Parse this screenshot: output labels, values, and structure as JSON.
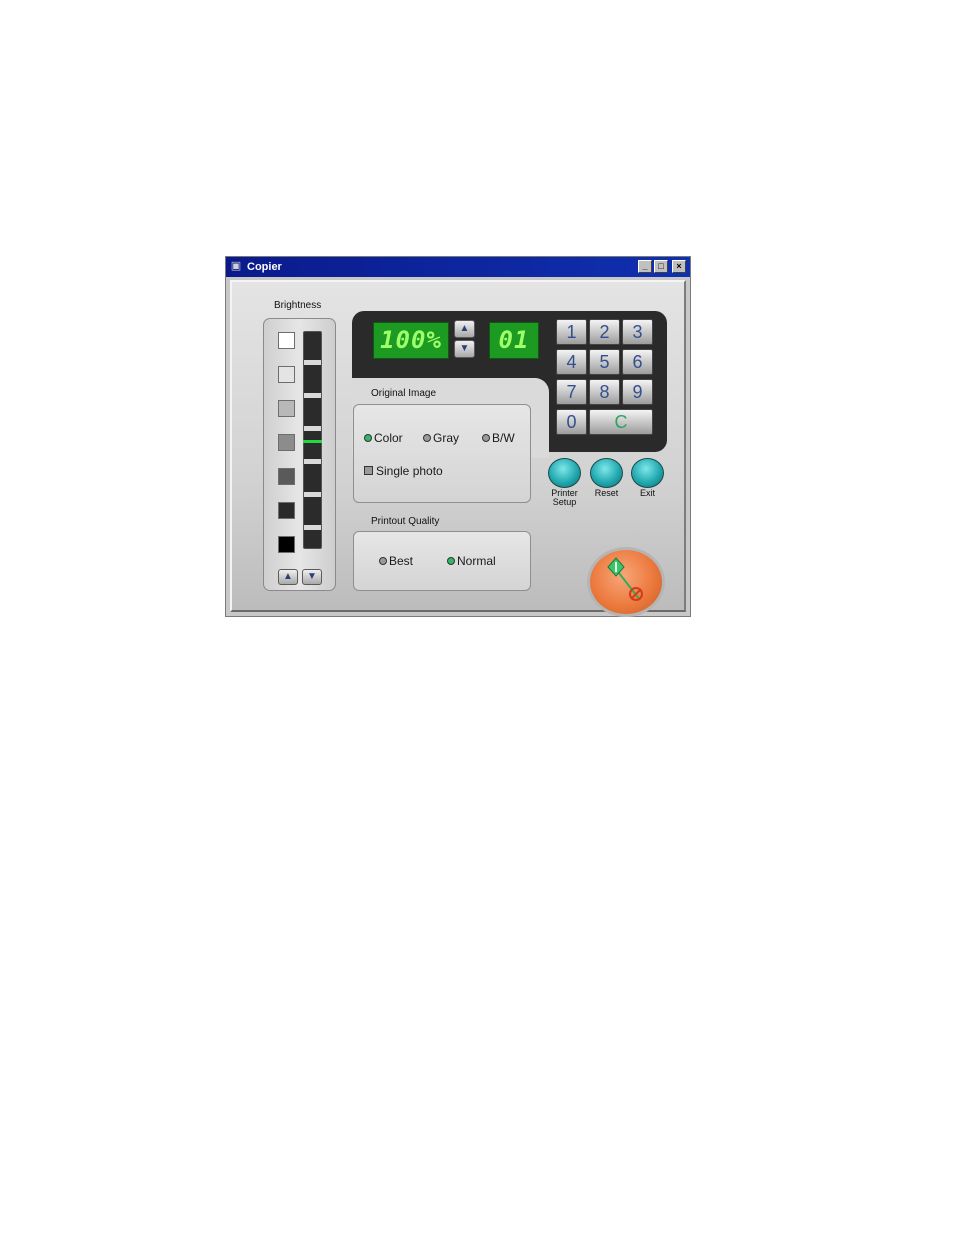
{
  "window": {
    "title": "Copier"
  },
  "brightness": {
    "label": "Brightness",
    "swatches": [
      "#ffffff",
      "#e4e4e4",
      "#b8b8b8",
      "#8c8c8c",
      "#5a5a5a",
      "#2a2a2a",
      "#000000"
    ],
    "level": 4,
    "levels": 7
  },
  "display": {
    "zoom": "100%",
    "copies": "01"
  },
  "keypad": {
    "keys": [
      "1",
      "2",
      "3",
      "4",
      "5",
      "6",
      "7",
      "8",
      "9",
      "0"
    ],
    "clear": "C"
  },
  "original_image": {
    "label": "Original Image",
    "options": [
      "Color",
      "Gray",
      "B/W"
    ],
    "selected": "Color",
    "single_photo": "Single photo"
  },
  "printout_quality": {
    "label": "Printout Quality",
    "options": [
      "Best",
      "Normal"
    ],
    "selected": "Normal"
  },
  "actions": {
    "printer_setup": "Printer Setup",
    "reset": "Reset",
    "exit": "Exit"
  },
  "colors": {
    "titlebar": "#0a1a8c",
    "lcd": "#1d9a21",
    "accent_teal": "#22a9b0",
    "start_orange": "#ec7a3e"
  }
}
